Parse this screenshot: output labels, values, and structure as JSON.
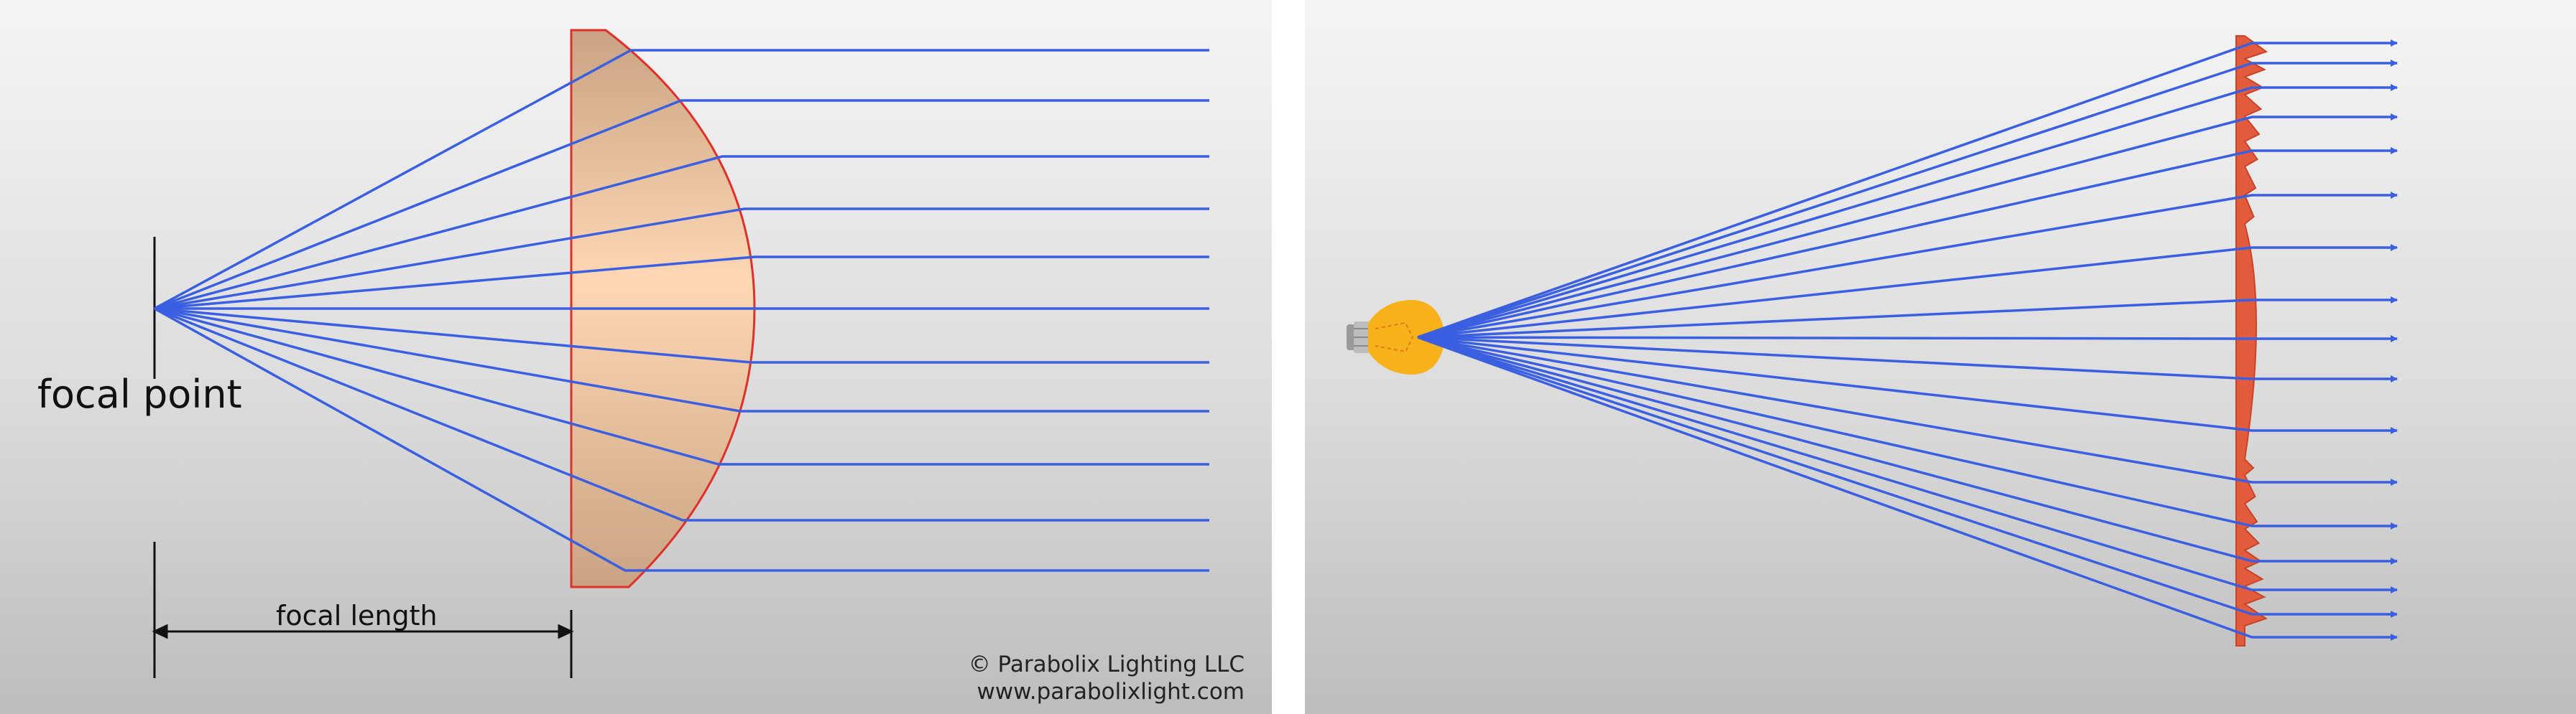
{
  "left": {
    "focal_point_label": "focal point",
    "focal_length_label": "focal length",
    "copyright": "© Parabolix Lighting LLC",
    "website": "www.parabolixlight.com"
  },
  "colors": {
    "ray": "#3a5fe0",
    "lens_fill": "#fdd3b0",
    "lens_edge": "#e0302a",
    "fresnel_fill": "#e25b3c",
    "bulb": "#f7b21b",
    "background_top": "#f5f5f5",
    "background_bottom": "#bdbdbd"
  },
  "icons": {
    "light_source": "light-bulb-icon"
  }
}
